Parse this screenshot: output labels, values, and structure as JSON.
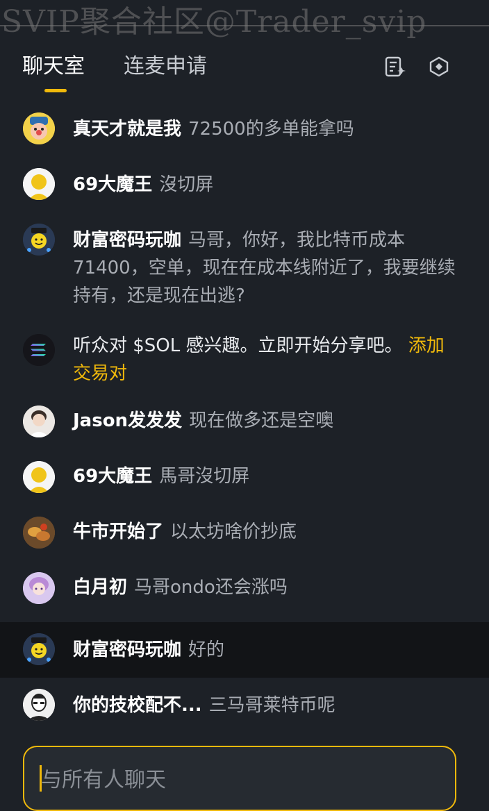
{
  "watermark": "SVIP聚合社区@Trader_svip",
  "tabs": {
    "active": "聊天室",
    "inactive": "连麦申请"
  },
  "icons": {
    "notes": "notes-icon",
    "settings": "hexagon-settings-icon"
  },
  "colors": {
    "accent": "#f0b90b",
    "background": "#1d2127",
    "highlight_row": "#121417"
  },
  "messages": [
    {
      "name": "真天才就是我",
      "text": "72500的多单能拿吗",
      "avatar": "clown-avatar"
    },
    {
      "name": "69大魔王",
      "text": "沒切屏",
      "avatar": "default-avatar"
    },
    {
      "name": "财富密码玩咖",
      "text": "马哥，你好，我比特币成本71400，空单，现在在成本线附近了，我要继续持有，还是现在出逃?",
      "avatar": "smiley-avatar"
    },
    {
      "name": "",
      "text": "听众对 $SOL 感兴趣。立即开始分享吧。",
      "link": "添加交易对",
      "avatar": "solana-avatar"
    },
    {
      "name": "Jason发发发",
      "text": "现在做多还是空噢",
      "avatar": "photo-avatar"
    },
    {
      "name": "69大魔王",
      "text": "馬哥沒切屏",
      "avatar": "default-avatar"
    },
    {
      "name": "牛市开始了",
      "text": "以太坊啥价抄底",
      "avatar": "food-avatar"
    },
    {
      "name": "白月初",
      "text": "马哥ondo还会涨吗",
      "avatar": "anime-avatar"
    },
    {
      "name": "财富密码玩咖",
      "text": "好的",
      "avatar": "smiley-avatar"
    },
    {
      "name": "你的技校配不...",
      "text": "三马哥莱特币呢",
      "avatar": "sketch-avatar"
    }
  ],
  "input": {
    "placeholder": "与所有人聊天",
    "value": ""
  }
}
